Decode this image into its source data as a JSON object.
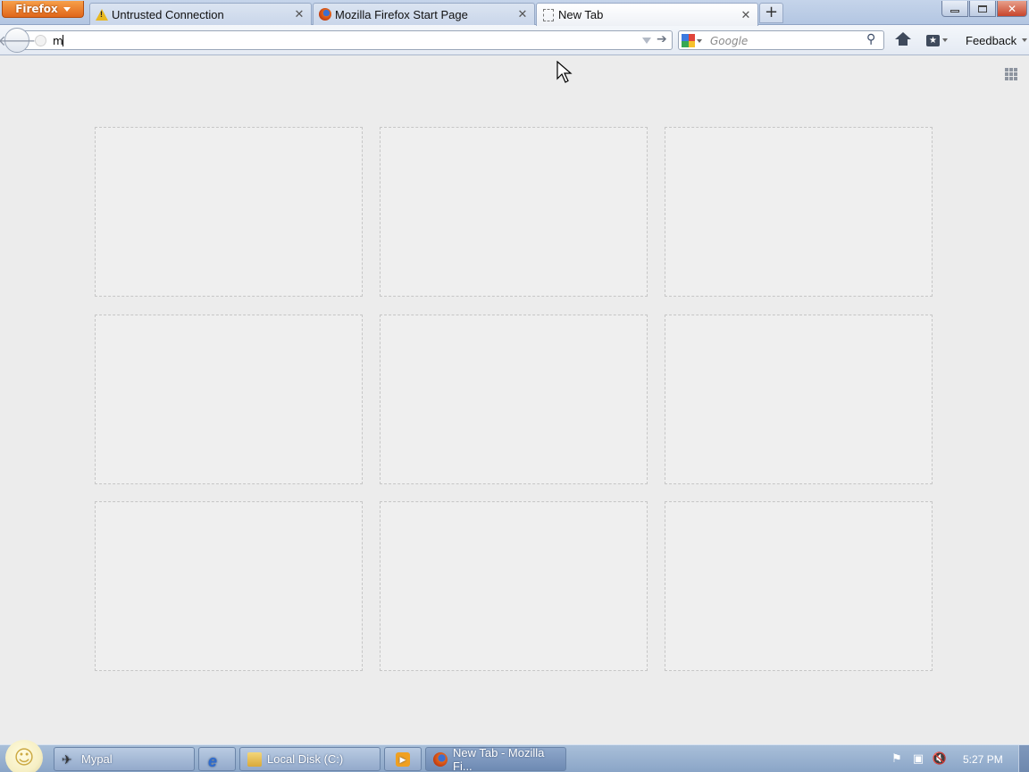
{
  "app_menu": {
    "label": "Firefox"
  },
  "tabs": [
    {
      "label": "Untrusted Connection",
      "icon": "warning-icon"
    },
    {
      "label": "Mozilla Firefox Start Page",
      "icon": "firefox-icon"
    },
    {
      "label": "New Tab",
      "icon": "blank-page-icon",
      "selected": true
    }
  ],
  "navbar": {
    "url_value": "m",
    "search_placeholder": "Google",
    "search_engine": "Google",
    "feedback_label": "Feedback"
  },
  "new_tab_page": {
    "cells": 9
  },
  "taskbar": {
    "buttons": [
      {
        "label": "Mypal",
        "icon": "mypal-icon"
      },
      {
        "label": "",
        "icon": "ie-icon"
      },
      {
        "label": "Local Disk (C:)",
        "icon": "folder-icon"
      },
      {
        "label": "",
        "icon": "media-player-icon"
      },
      {
        "label": "New Tab - Mozilla Fi...",
        "icon": "firefox-icon",
        "active": true
      }
    ],
    "clock": "5:27 PM"
  },
  "colors": {
    "accent": "#e0661a",
    "titlebar": "#b3c6e2",
    "content_bg": "#ececec",
    "taskbar": "#8aa5c7"
  }
}
